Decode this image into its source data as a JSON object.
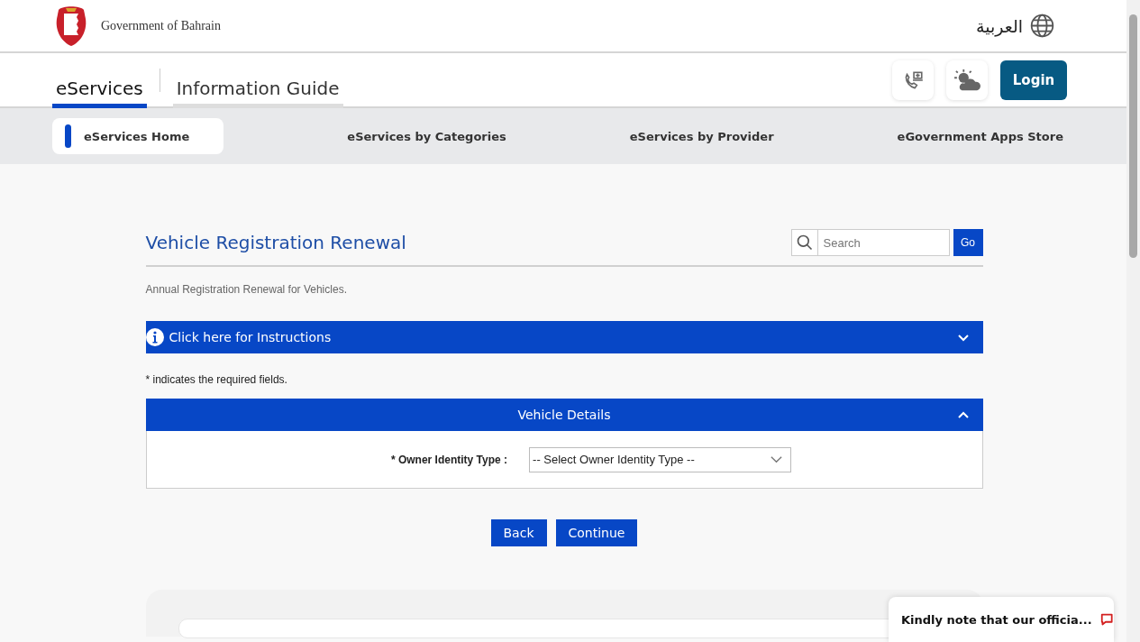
{
  "header": {
    "logo_text": "Government of Bahrain",
    "language": "العربية"
  },
  "tabs": [
    {
      "label": "eServices",
      "selected": true
    },
    {
      "label": "Information Guide",
      "selected": false
    }
  ],
  "login": "Login",
  "nav": [
    {
      "label": "eServices Home",
      "selected": true
    },
    {
      "label": "eServices by Categories",
      "selected": false
    },
    {
      "label": "eServices by Provider",
      "selected": false
    },
    {
      "label": "eGovernment Apps Store",
      "selected": false
    }
  ],
  "page": {
    "title": "Vehicle Registration Renewal",
    "search": {
      "placeholder": "Search"
    },
    "go": "Go",
    "description": "Annual Registration Renewal for Vehicles."
  },
  "instructions": {
    "label": "Click here for Instructions",
    "expanded": false
  },
  "required_note": "* indicates the required fields.",
  "section": {
    "title": "Vehicle Details",
    "expanded": true,
    "fields": [
      {
        "label": "* Owner Identity Type :",
        "value": "-- Select Owner Identity Type --"
      }
    ]
  },
  "buttons": [
    "Back",
    "Continue"
  ],
  "toast": "Kindly note that our officia..."
}
